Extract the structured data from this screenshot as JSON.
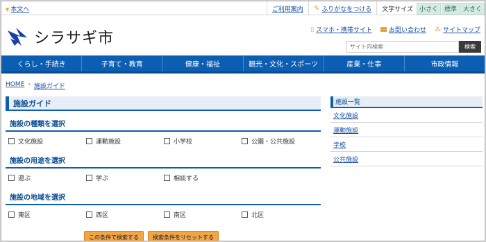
{
  "topbar": {
    "skip_label": "本文へ",
    "links": [
      "ご利用案内",
      "ふりがなをつける"
    ],
    "font_size_label": "文字サイズ",
    "font_sizes": [
      "小さく",
      "標準",
      "大きく"
    ]
  },
  "header": {
    "logo_text": "シラサギ市",
    "links": [
      "スマホ・携帯サイト",
      "お問い合わせ",
      "サイトマップ"
    ],
    "search_placeholder": "サイト内検索",
    "search_button": "検索"
  },
  "nav": [
    "くらし・手続き",
    "子育て・教育",
    "健康・福祉",
    "観光・文化・スポーツ",
    "産業・仕事",
    "市政情報"
  ],
  "breadcrumb": [
    "HOME",
    "施設ガイド"
  ],
  "main": {
    "title": "施設ガイド",
    "sections": [
      {
        "heading": "施設の種類を選択",
        "options": [
          "文化施設",
          "運動施設",
          "小学校",
          "公園・公共施設"
        ]
      },
      {
        "heading": "施設の用途を選択",
        "options": [
          "遊ぶ",
          "学ぶ",
          "相談する"
        ]
      },
      {
        "heading": "施設の地域を選択",
        "options": [
          "東区",
          "西区",
          "南区",
          "北区"
        ]
      }
    ],
    "search_button": "この条件で検索する",
    "reset_button": "検索条件をリセットする"
  },
  "sidebar": {
    "heading": "施設一覧",
    "items": [
      "文化施設",
      "運動施設",
      "学校",
      "公共施設"
    ]
  },
  "colors": {
    "brand": "#0b5eb1",
    "accent": "#f2a544",
    "logo": "#1a3fa8"
  }
}
